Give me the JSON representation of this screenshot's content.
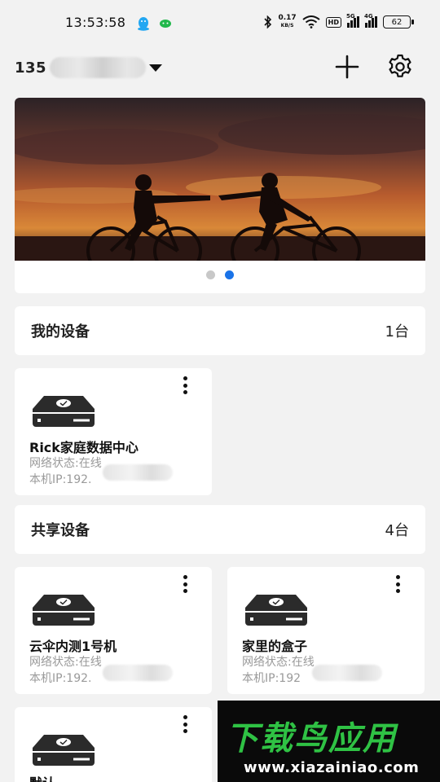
{
  "status_bar": {
    "time": "13:53:58",
    "net_speed": "0.17",
    "net_unit": "KB/S",
    "hd_label": "HD",
    "sig1_label": "5G",
    "sig2_label": "4G",
    "battery": "62",
    "qq_color": "#23a7f2",
    "wechat_color": "#22b84c"
  },
  "header": {
    "account_prefix": "135"
  },
  "banner": {
    "slide_count": 2,
    "active_slide": 2
  },
  "my_devices": {
    "title": "我的设备",
    "count": "1台",
    "items": [
      {
        "name": "Rick家庭数据中心",
        "status": "网络状态:在线",
        "ip": "本机IP:192."
      }
    ]
  },
  "shared_devices": {
    "title": "共享设备",
    "count": "4台",
    "items": [
      {
        "name": "云伞内测1号机",
        "status": "网络状态:在线",
        "ip": "本机IP:192."
      },
      {
        "name": "家里的盒子",
        "status": "网络状态:在线",
        "ip": "本机IP:192"
      },
      {
        "name": "默认"
      }
    ]
  },
  "watermark": {
    "title": "下载鸟应用",
    "url": "www.xiazainiao.com"
  },
  "colors": {
    "accent": "#1a73e8",
    "watermark_green": "#2fc244"
  }
}
